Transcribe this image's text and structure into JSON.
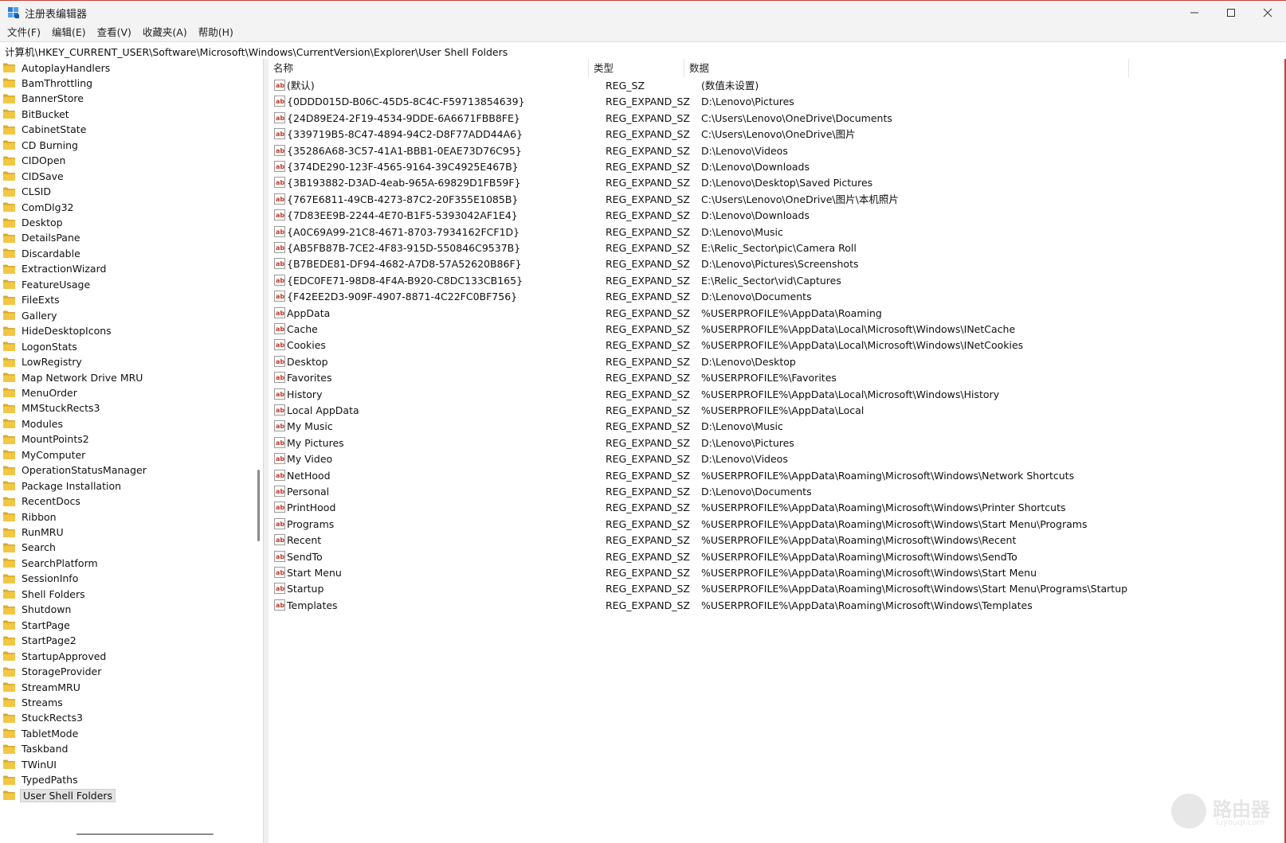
{
  "window": {
    "title": "注册表编辑器",
    "controls": {
      "minimize": "—",
      "maximize": "☐",
      "close": "✕"
    }
  },
  "menu": [
    "文件(F)",
    "编辑(E)",
    "查看(V)",
    "收藏夹(A)",
    "帮助(H)"
  ],
  "address": "计算机\\HKEY_CURRENT_USER\\Software\\Microsoft\\Windows\\CurrentVersion\\Explorer\\User Shell Folders",
  "tree": {
    "items": [
      "AutoplayHandlers",
      "BamThrottling",
      "BannerStore",
      "BitBucket",
      "CabinetState",
      "CD Burning",
      "CIDOpen",
      "CIDSave",
      "CLSID",
      "ComDlg32",
      "Desktop",
      "DetailsPane",
      "Discardable",
      "ExtractionWizard",
      "FeatureUsage",
      "FileExts",
      "Gallery",
      "HideDesktopIcons",
      "LogonStats",
      "LowRegistry",
      "Map Network Drive MRU",
      "MenuOrder",
      "MMStuckRects3",
      "Modules",
      "MountPoints2",
      "MyComputer",
      "OperationStatusManager",
      "Package Installation",
      "RecentDocs",
      "Ribbon",
      "RunMRU",
      "Search",
      "SearchPlatform",
      "SessionInfo",
      "Shell Folders",
      "Shutdown",
      "StartPage",
      "StartPage2",
      "StartupApproved",
      "StorageProvider",
      "StreamMRU",
      "Streams",
      "StuckRects3",
      "TabletMode",
      "Taskband",
      "TWinUI",
      "TypedPaths",
      "User Shell Folders"
    ],
    "selected": "User Shell Folders"
  },
  "columns": {
    "name": "名称",
    "type": "类型",
    "data": "数据"
  },
  "values": [
    {
      "name": "(默认)",
      "type": "REG_SZ",
      "data": "(数值未设置)"
    },
    {
      "name": "{0DDD015D-B06C-45D5-8C4C-F59713854639}",
      "type": "REG_EXPAND_SZ",
      "data": "D:\\Lenovo\\Pictures"
    },
    {
      "name": "{24D89E24-2F19-4534-9DDE-6A6671FBB8FE}",
      "type": "REG_EXPAND_SZ",
      "data": "C:\\Users\\Lenovo\\OneDrive\\Documents"
    },
    {
      "name": "{339719B5-8C47-4894-94C2-D8F77ADD44A6}",
      "type": "REG_EXPAND_SZ",
      "data": "C:\\Users\\Lenovo\\OneDrive\\图片"
    },
    {
      "name": "{35286A68-3C57-41A1-BBB1-0EAE73D76C95}",
      "type": "REG_EXPAND_SZ",
      "data": "D:\\Lenovo\\Videos"
    },
    {
      "name": "{374DE290-123F-4565-9164-39C4925E467B}",
      "type": "REG_EXPAND_SZ",
      "data": "D:\\Lenovo\\Downloads"
    },
    {
      "name": "{3B193882-D3AD-4eab-965A-69829D1FB59F}",
      "type": "REG_EXPAND_SZ",
      "data": "D:\\Lenovo\\Desktop\\Saved Pictures"
    },
    {
      "name": "{767E6811-49CB-4273-87C2-20F355E1085B}",
      "type": "REG_EXPAND_SZ",
      "data": "C:\\Users\\Lenovo\\OneDrive\\图片\\本机照片"
    },
    {
      "name": "{7D83EE9B-2244-4E70-B1F5-5393042AF1E4}",
      "type": "REG_EXPAND_SZ",
      "data": "D:\\Lenovo\\Downloads"
    },
    {
      "name": "{A0C69A99-21C8-4671-8703-7934162FCF1D}",
      "type": "REG_EXPAND_SZ",
      "data": "D:\\Lenovo\\Music"
    },
    {
      "name": "{AB5FB87B-7CE2-4F83-915D-550846C9537B}",
      "type": "REG_EXPAND_SZ",
      "data": "E:\\Relic_Sector\\pic\\Camera Roll"
    },
    {
      "name": "{B7BEDE81-DF94-4682-A7D8-57A52620B86F}",
      "type": "REG_EXPAND_SZ",
      "data": "D:\\Lenovo\\Pictures\\Screenshots"
    },
    {
      "name": "{EDC0FE71-98D8-4F4A-B920-C8DC133CB165}",
      "type": "REG_EXPAND_SZ",
      "data": "E:\\Relic_Sector\\vid\\Captures"
    },
    {
      "name": "{F42EE2D3-909F-4907-8871-4C22FC0BF756}",
      "type": "REG_EXPAND_SZ",
      "data": "D:\\Lenovo\\Documents"
    },
    {
      "name": "AppData",
      "type": "REG_EXPAND_SZ",
      "data": "%USERPROFILE%\\AppData\\Roaming"
    },
    {
      "name": "Cache",
      "type": "REG_EXPAND_SZ",
      "data": "%USERPROFILE%\\AppData\\Local\\Microsoft\\Windows\\INetCache"
    },
    {
      "name": "Cookies",
      "type": "REG_EXPAND_SZ",
      "data": "%USERPROFILE%\\AppData\\Local\\Microsoft\\Windows\\INetCookies"
    },
    {
      "name": "Desktop",
      "type": "REG_EXPAND_SZ",
      "data": "D:\\Lenovo\\Desktop"
    },
    {
      "name": "Favorites",
      "type": "REG_EXPAND_SZ",
      "data": "%USERPROFILE%\\Favorites"
    },
    {
      "name": "History",
      "type": "REG_EXPAND_SZ",
      "data": "%USERPROFILE%\\AppData\\Local\\Microsoft\\Windows\\History"
    },
    {
      "name": "Local AppData",
      "type": "REG_EXPAND_SZ",
      "data": "%USERPROFILE%\\AppData\\Local"
    },
    {
      "name": "My Music",
      "type": "REG_EXPAND_SZ",
      "data": "D:\\Lenovo\\Music"
    },
    {
      "name": "My Pictures",
      "type": "REG_EXPAND_SZ",
      "data": "D:\\Lenovo\\Pictures"
    },
    {
      "name": "My Video",
      "type": "REG_EXPAND_SZ",
      "data": "D:\\Lenovo\\Videos"
    },
    {
      "name": "NetHood",
      "type": "REG_EXPAND_SZ",
      "data": "%USERPROFILE%\\AppData\\Roaming\\Microsoft\\Windows\\Network Shortcuts"
    },
    {
      "name": "Personal",
      "type": "REG_EXPAND_SZ",
      "data": "D:\\Lenovo\\Documents"
    },
    {
      "name": "PrintHood",
      "type": "REG_EXPAND_SZ",
      "data": "%USERPROFILE%\\AppData\\Roaming\\Microsoft\\Windows\\Printer Shortcuts"
    },
    {
      "name": "Programs",
      "type": "REG_EXPAND_SZ",
      "data": "%USERPROFILE%\\AppData\\Roaming\\Microsoft\\Windows\\Start Menu\\Programs"
    },
    {
      "name": "Recent",
      "type": "REG_EXPAND_SZ",
      "data": "%USERPROFILE%\\AppData\\Roaming\\Microsoft\\Windows\\Recent"
    },
    {
      "name": "SendTo",
      "type": "REG_EXPAND_SZ",
      "data": "%USERPROFILE%\\AppData\\Roaming\\Microsoft\\Windows\\SendTo"
    },
    {
      "name": "Start Menu",
      "type": "REG_EXPAND_SZ",
      "data": "%USERPROFILE%\\AppData\\Roaming\\Microsoft\\Windows\\Start Menu"
    },
    {
      "name": "Startup",
      "type": "REG_EXPAND_SZ",
      "data": "%USERPROFILE%\\AppData\\Roaming\\Microsoft\\Windows\\Start Menu\\Programs\\Startup"
    },
    {
      "name": "Templates",
      "type": "REG_EXPAND_SZ",
      "data": "%USERPROFILE%\\AppData\\Roaming\\Microsoft\\Windows\\Templates"
    }
  ],
  "watermark": {
    "text": "路由器",
    "sub": "luyouqi.com"
  },
  "colors": {
    "folder": "#f2c744",
    "folder_dark": "#d9a92a",
    "ab_icon": "#c0392b",
    "selected_bg": "#e3e3e3",
    "accent_edge": "#c9403c"
  }
}
